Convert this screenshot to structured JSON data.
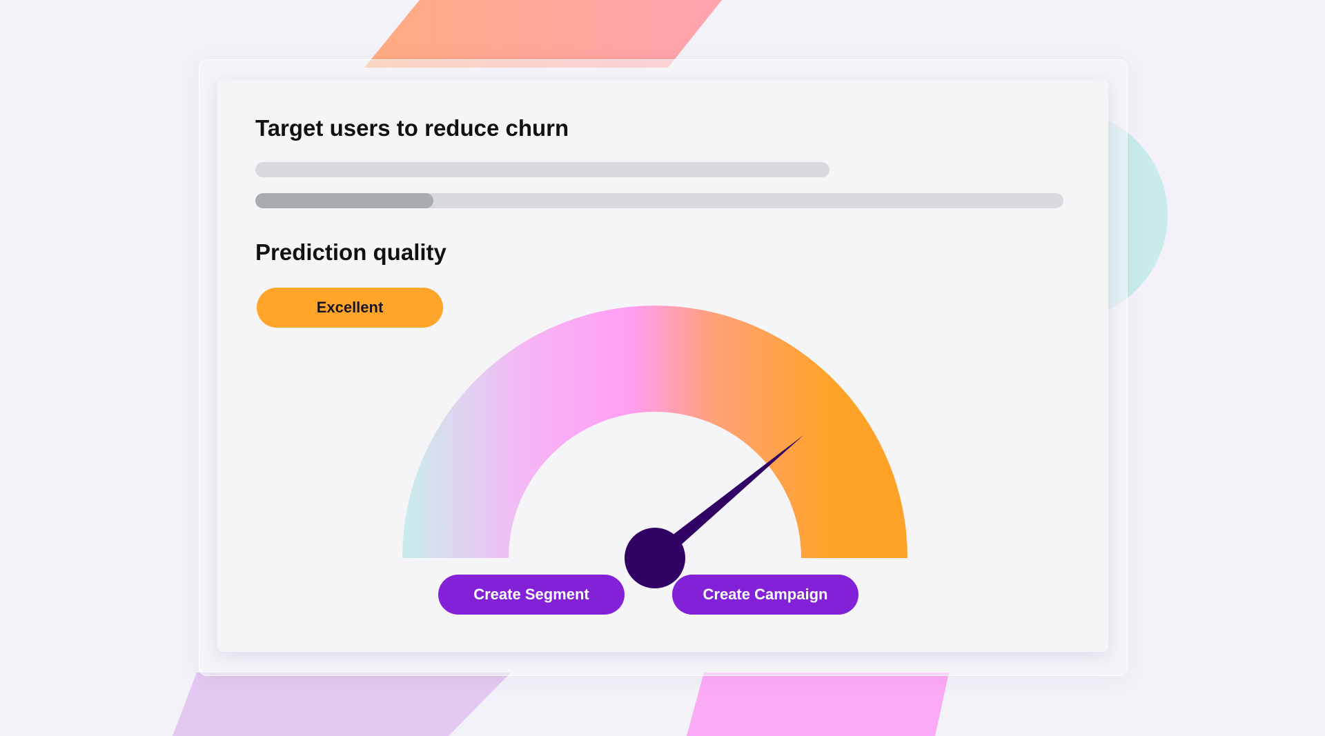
{
  "card": {
    "title": "Target users to reduce churn",
    "section_title": "Prediction quality",
    "progress_fraction": 0.22
  },
  "quality": {
    "badge_label": "Excellent",
    "badge_color": "#ffa52a",
    "gauge_value": 0.78
  },
  "actions": {
    "create_segment_label": "Create Segment",
    "create_campaign_label": "Create Campaign",
    "button_color": "#8321d8"
  },
  "colors": {
    "needle": "#310264",
    "gradient": [
      "#c9eeec",
      "#f6b5f5",
      "#ff9ef4",
      "#ffa176",
      "#ffa328"
    ]
  }
}
